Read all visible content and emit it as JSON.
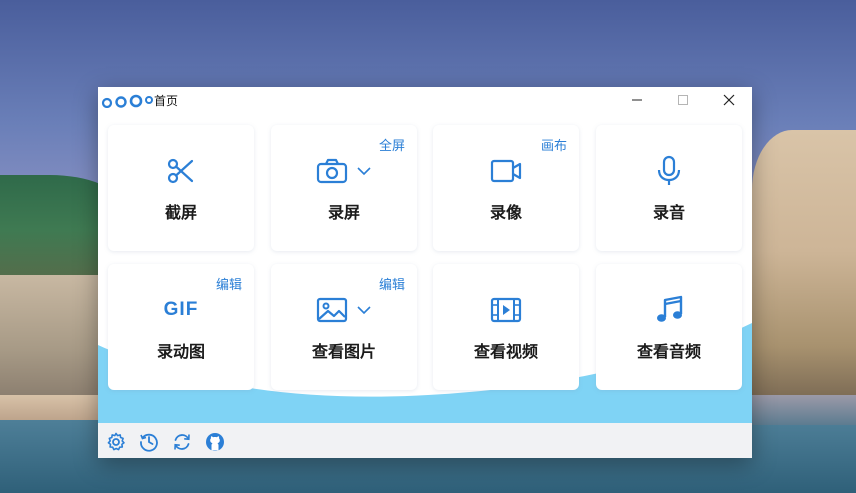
{
  "window": {
    "title": "首页",
    "controls": {
      "minimize": "—",
      "maximize": "☐",
      "close": "✕"
    }
  },
  "colors": {
    "accent": "#2b7fd6",
    "wave": "#7fd3f5",
    "bottom_bar": "#f1f2f4"
  },
  "cards": [
    {
      "label": "截屏",
      "tag": "",
      "icon": "scissors-icon"
    },
    {
      "label": "录屏",
      "tag": "全屏",
      "icon": "camera-icon"
    },
    {
      "label": "录像",
      "tag": "画布",
      "icon": "video-camera-icon"
    },
    {
      "label": "录音",
      "tag": "",
      "icon": "microphone-icon"
    },
    {
      "label": "录动图",
      "tag": "编辑",
      "icon": "gif-icon",
      "icon_text": "GIF"
    },
    {
      "label": "查看图片",
      "tag": "编辑",
      "icon": "image-icon"
    },
    {
      "label": "查看视频",
      "tag": "",
      "icon": "film-icon"
    },
    {
      "label": "查看音频",
      "tag": "",
      "icon": "music-note-icon"
    }
  ],
  "bottom_icons": [
    "settings-icon",
    "history-icon",
    "refresh-icon",
    "github-icon"
  ]
}
